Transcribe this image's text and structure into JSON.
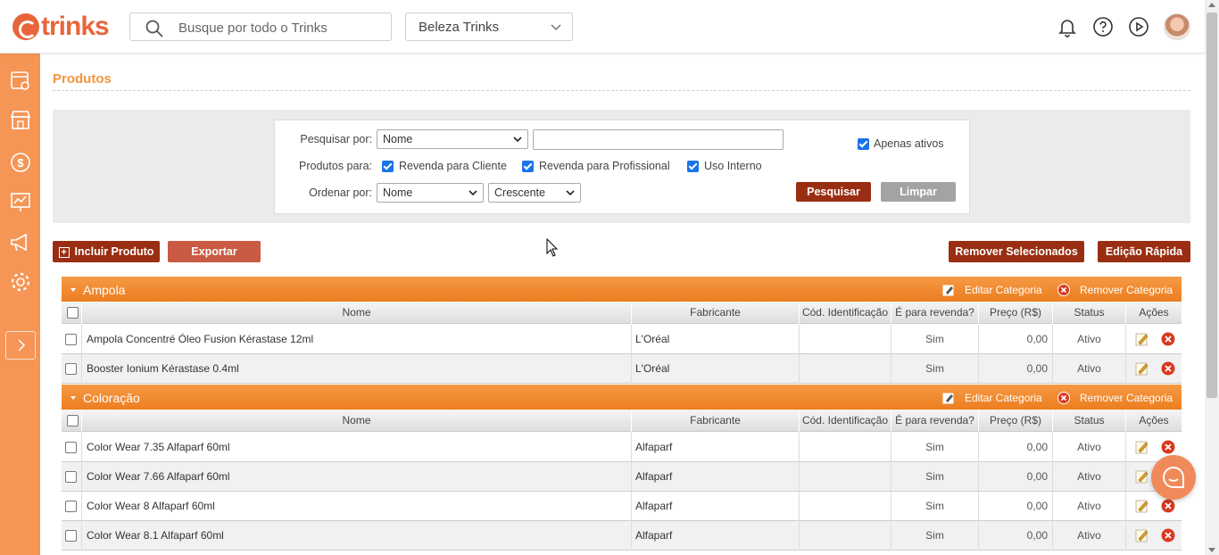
{
  "header": {
    "logo_text": "trinks",
    "search_placeholder": "Busque por todo o Trinks",
    "establishment": "Beleza Trinks"
  },
  "page": {
    "title": "Produtos"
  },
  "filter": {
    "search_by_label": "Pesquisar por:",
    "search_by_value": "Nome",
    "search_text": "",
    "products_for_label": "Produtos para:",
    "resale_client": "Revenda para Cliente",
    "resale_professional": "Revenda para Profissional",
    "internal_use": "Uso Interno",
    "only_active": "Apenas ativos",
    "order_by_label": "Ordenar por:",
    "order_by_value": "Nome",
    "order_dir_value": "Crescente",
    "search_button": "Pesquisar",
    "clear_button": "Limpar"
  },
  "actions": {
    "include_product": "Incluir Produto",
    "export": "Exportar",
    "remove_selected": "Remover Selecionados",
    "quick_edit": "Edição Rápida"
  },
  "table_headers": [
    "Nome",
    "Fabricante",
    "Cód. Identificação",
    "É para revenda?",
    "Preço (R$)",
    "Status",
    "Ações"
  ],
  "categories": [
    {
      "name": "Ampola",
      "edit_label": "Editar Categoria",
      "remove_label": "Remover Categoria",
      "rows": [
        {
          "name": "Ampola Concentré Óleo Fusion Kérastase 12ml",
          "maker": "L'Oréal",
          "code": "",
          "resale": "Sim",
          "price": "0,00",
          "status": "Ativo"
        },
        {
          "name": "Booster Ionium Kérastase 0.4ml",
          "maker": "L'Oréal",
          "code": "",
          "resale": "Sim",
          "price": "0,00",
          "status": "Ativo"
        }
      ]
    },
    {
      "name": "Coloração",
      "edit_label": "Editar Categoria",
      "remove_label": "Remover Categoria",
      "rows": [
        {
          "name": "Color Wear 7.35 Alfaparf 60ml",
          "maker": "Alfaparf",
          "code": "",
          "resale": "Sim",
          "price": "0,00",
          "status": "Ativo"
        },
        {
          "name": "Color Wear 7.66 Alfaparf 60ml",
          "maker": "Alfaparf",
          "code": "",
          "resale": "Sim",
          "price": "0,00",
          "status": "Ativo"
        },
        {
          "name": "Color Wear 8 Alfaparf 60ml",
          "maker": "Alfaparf",
          "code": "",
          "resale": "Sim",
          "price": "0,00",
          "status": "Ativo"
        },
        {
          "name": "Color Wear 8.1 Alfaparf 60ml",
          "maker": "Alfaparf",
          "code": "",
          "resale": "Sim",
          "price": "0,00",
          "status": "Ativo"
        }
      ]
    }
  ],
  "colors": {
    "brand": "#e8653a",
    "sidebar": "#f59556",
    "category_bar": "#f08a2c",
    "button_dark": "#9a2e12"
  }
}
